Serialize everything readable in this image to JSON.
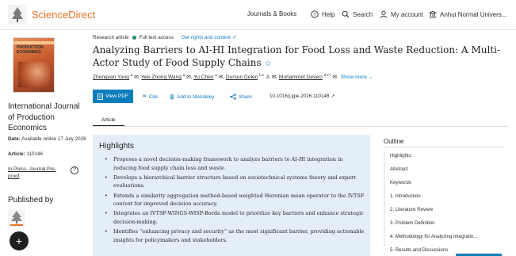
{
  "header": {
    "brand": "ScienceDirect",
    "nav": {
      "journals": "Journals & Books",
      "help": "Help",
      "search": "Search",
      "account": "My account",
      "institution": "Anhui Normal Univers..."
    }
  },
  "sidebar": {
    "cover_title": "PRODUCTION ECONOMICS",
    "journal": "International Journal of Production Economics",
    "date_label": "Date:",
    "date_value": "Available online 17 July 2026",
    "article_label": "Article:",
    "article_value": "110146",
    "in_press": "In Press, Journal Pre-proof",
    "help_glyph": "?",
    "published_by": "Published by",
    "fab_glyph": "+"
  },
  "article": {
    "type": "Research article",
    "access": "Full text access",
    "rights": "Get rights and content ↗",
    "title": "Analyzing Barriers to AI-HI Integration for Food Loss and Waste Reduction: A Multi-Actor Study of Food Supply Chains",
    "star": "☆",
    "authors": [
      {
        "name": "Zhengyan Yang",
        "sup": "a"
      },
      {
        "name": "Wei Zhong Wang",
        "sup": "a"
      },
      {
        "name": "Yu Chen",
        "sup": "a"
      },
      {
        "name": "Dursun Delen",
        "sup": "b c"
      },
      {
        "name": "Muhammet Deveci",
        "sup": "d e f"
      }
    ],
    "show_more": "Show more",
    "actions": {
      "view_pdf": "View PDF",
      "cite": "Cite",
      "mendeley": "Add to Mendeley",
      "share": "Share",
      "doi": "10.1016/j.ijpe.2026.110146 ↗"
    },
    "tab": "Article"
  },
  "highlights": {
    "title": "Highlights",
    "items": [
      "Proposes a novel decision-making framework to analyze barriers to AI-HI integration in reducing food supply chain loss and waste.",
      "Develops a hierarchical barrier structure based on sociotechnical systems theory and expert evaluations.",
      "Extends a similarity aggregation method-based weighted Heronian mean operator to the IVTSF context for improved decision accuracy.",
      "Integrates an IVTSF-WINGS-WISP-Borda model to prioritize key barriers and enhance strategic decision-making.",
      "Identifies “enhancing privacy and security” as the most significant barrier, providing actionable insights for policymakers and stakeholders."
    ]
  },
  "outline": {
    "title": "Outline",
    "items": [
      "Highlights",
      "Abstract",
      "Keywords",
      "1. Introduction",
      "2. Literature Review",
      "3. Problem Definition",
      "4. Methodology for Analyzing Integratio...",
      "5. Results and Discussions"
    ]
  },
  "colors": {
    "brand": "#e9711c",
    "link": "#0c7dbb",
    "highlights_bg": "#e3eef9",
    "open_access_dot": "#1f8a70"
  }
}
